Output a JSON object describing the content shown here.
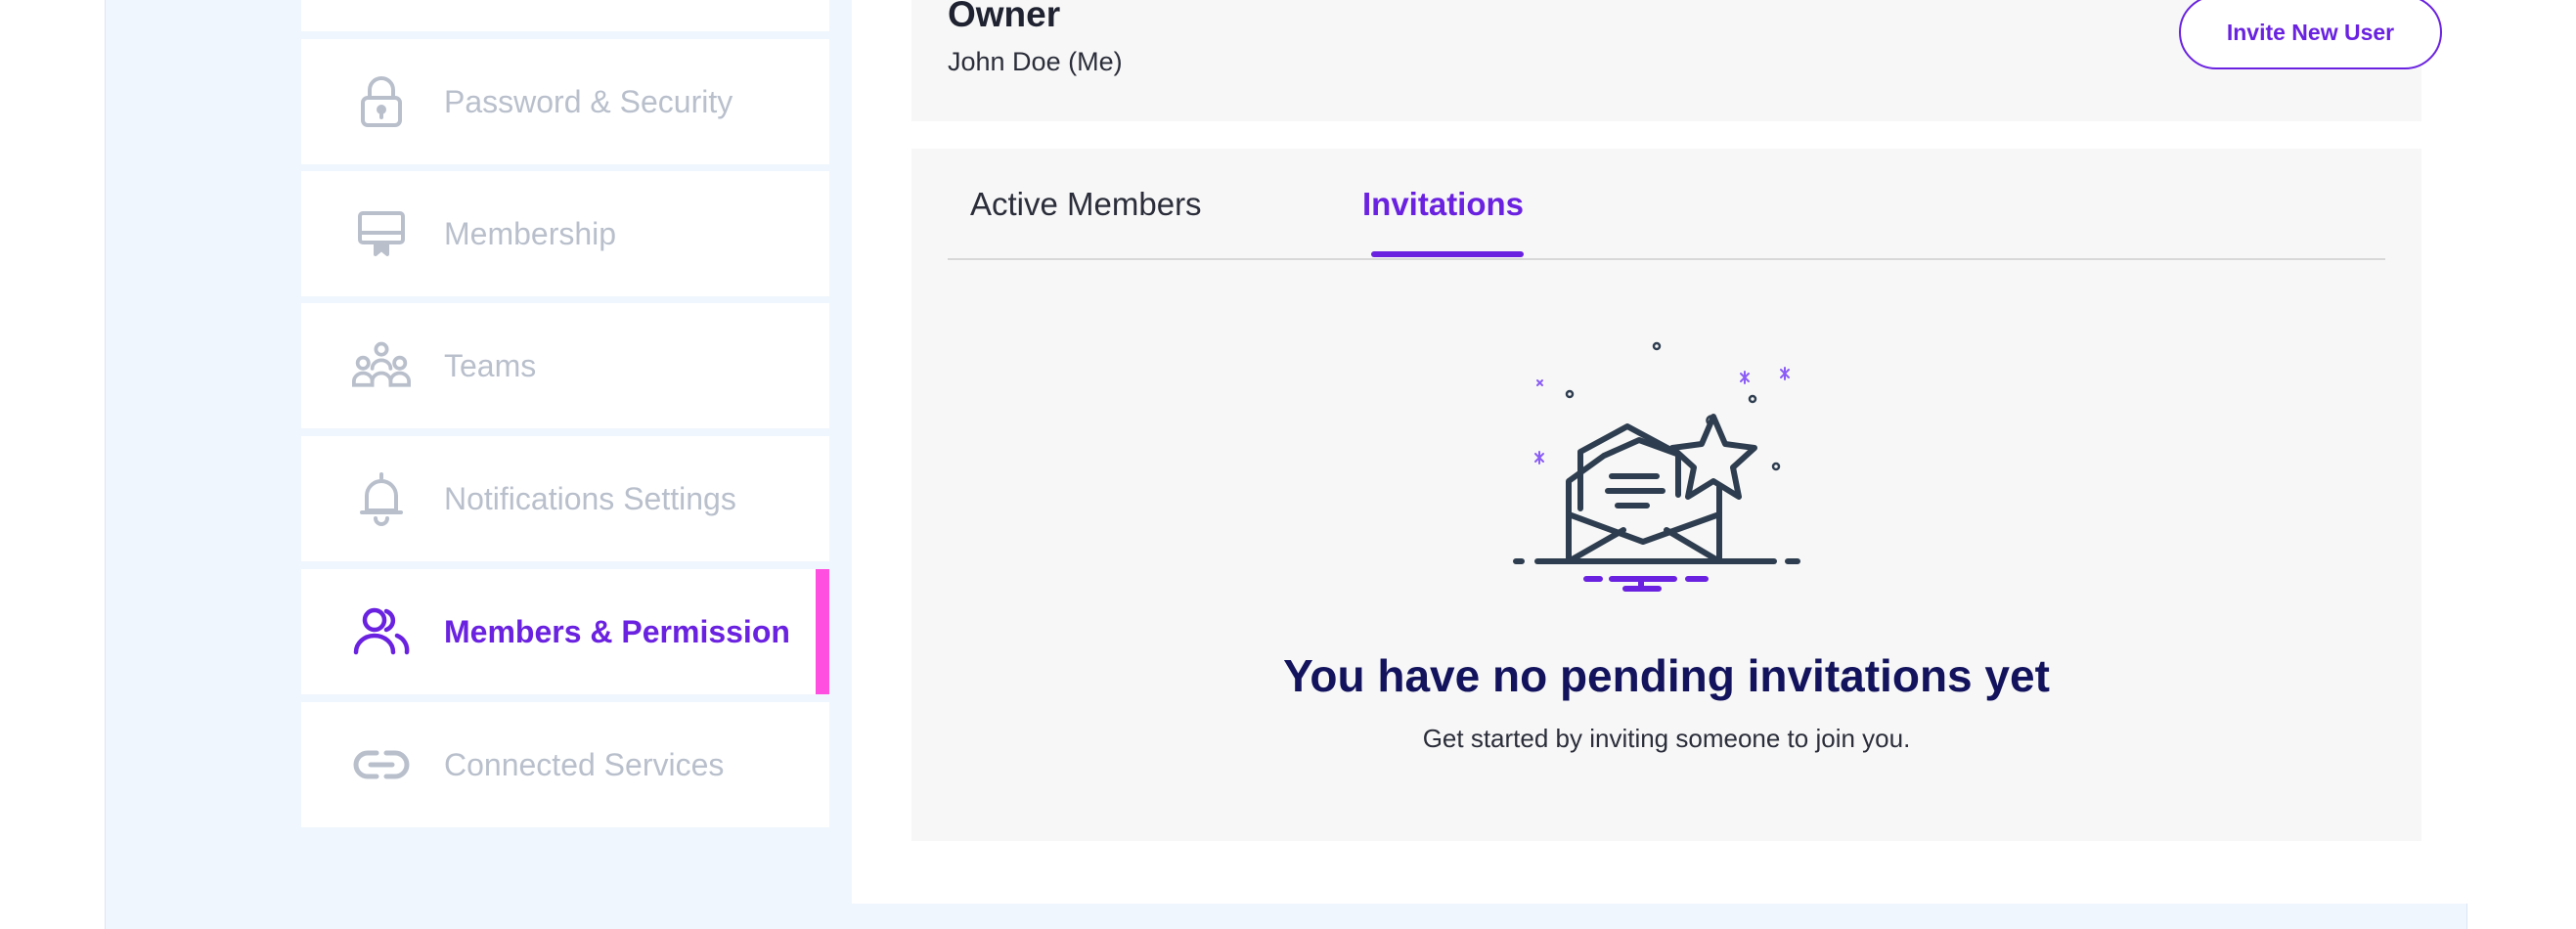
{
  "sidebar": {
    "items": [
      {
        "label": "Password & Security",
        "icon": "lock-icon"
      },
      {
        "label": "Membership",
        "icon": "membership-card-icon"
      },
      {
        "label": "Teams",
        "icon": "teams-icon"
      },
      {
        "label": "Notifications Settings",
        "icon": "bell-icon"
      },
      {
        "label": "Members & Permission",
        "icon": "users-icon",
        "active": true
      },
      {
        "label": "Connected Services",
        "icon": "link-icon"
      }
    ]
  },
  "owner": {
    "title": "Owner",
    "name": "John Doe (Me)",
    "invite_label": "Invite New User"
  },
  "tabs": [
    {
      "label": "Active Members"
    },
    {
      "label": "Invitations",
      "active": true
    }
  ],
  "empty_state": {
    "title": "You have no pending invitations yet",
    "subtitle": "Get started by inviting someone to join you.",
    "illustration": "open-envelope-star-icon"
  },
  "colors": {
    "accent": "#6a22e0",
    "active_marker": "#ff4fe0",
    "heading": "#12135c",
    "muted": "#b9c0cc",
    "background": "#f0f6fd"
  }
}
